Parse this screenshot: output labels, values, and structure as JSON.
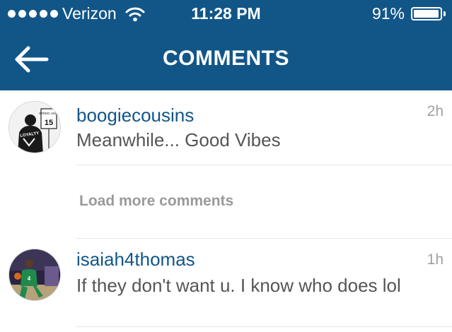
{
  "status_bar": {
    "carrier": "Verizon",
    "time": "11:28 PM",
    "battery_percent": "91%",
    "battery_level": 0.91,
    "signal_bars": 5
  },
  "header": {
    "title": "COMMENTS",
    "back_icon": "arrow-left-icon",
    "background_color": "#125688"
  },
  "comments": [
    {
      "username": "boogiecousins",
      "text": "Meanwhile... Good Vibes",
      "time": "2h",
      "avatar_caption": "LOYALTY",
      "avatar_sign_text": "SPEED LIMIT",
      "avatar_sign_number": "15"
    },
    {
      "username": "isaiah4thomas",
      "text": "If they don't want u. I know who does lol",
      "time": "1h"
    }
  ],
  "load_more_label": "Load more comments",
  "colors": {
    "username": "#125688",
    "comment_text": "#555555",
    "meta_text": "#a0a0a0"
  }
}
